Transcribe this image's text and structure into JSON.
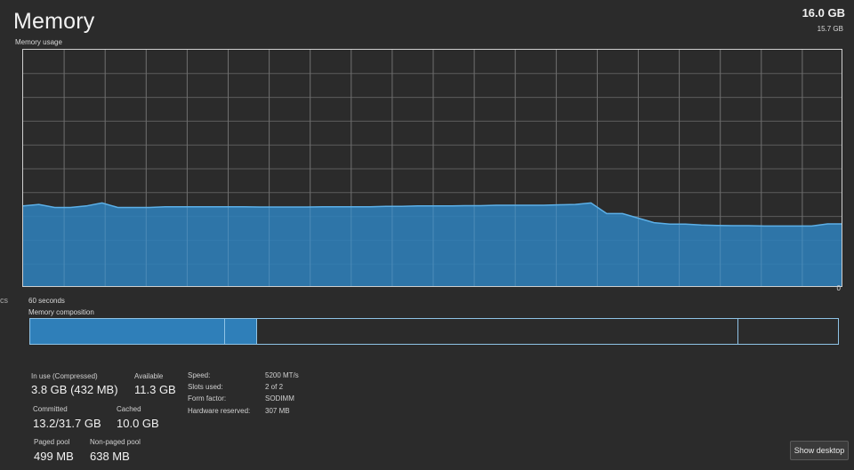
{
  "header": {
    "title": "Memory",
    "total": "16.0 GB"
  },
  "usage_graph": {
    "label": "Memory usage",
    "max": "15.7 GB",
    "time_span": "60 seconds",
    "zero": "0",
    "left_mark": "cs",
    "fill_color": "#2f7fb9",
    "line_color": "#5cb0e8"
  },
  "chart_data": {
    "type": "area",
    "x_span_seconds": 60,
    "ylim": [
      0,
      15.7
    ],
    "grid": true,
    "series": [
      {
        "values": [
          5.4,
          5.5,
          5.3,
          5.3,
          5.4,
          5.6,
          5.3,
          5.3,
          5.3,
          5.35,
          5.35,
          5.35,
          5.35,
          5.35,
          5.35,
          5.33,
          5.33,
          5.33,
          5.33,
          5.35,
          5.35,
          5.35,
          5.35,
          5.38,
          5.38,
          5.4,
          5.4,
          5.4,
          5.42,
          5.42,
          5.45,
          5.45,
          5.45,
          5.45,
          5.48,
          5.5,
          5.6,
          4.9,
          4.9,
          4.6,
          4.3,
          4.2,
          4.2,
          4.15,
          4.12,
          4.1,
          4.1,
          4.08,
          4.08,
          4.08,
          4.08,
          4.22,
          4.22
        ]
      }
    ]
  },
  "composition": {
    "label": "Memory composition",
    "segments": [
      {
        "name": "in-use",
        "fraction": 0.24,
        "color": "#2f7fb9"
      },
      {
        "name": "modified",
        "fraction": 0.04,
        "color": "#2f7fb9"
      },
      {
        "name": "standby",
        "fraction": 0.595,
        "color": "#2b2b2b"
      },
      {
        "name": "free",
        "fraction": 0.125,
        "color": "#2b2b2b"
      }
    ]
  },
  "stats": {
    "in_use_label": "In use (Compressed)",
    "in_use_value": "3.8 GB (432 MB)",
    "available_label": "Available",
    "available_value": "11.3 GB",
    "committed_label": "Committed",
    "committed_value": "13.2/31.7 GB",
    "cached_label": "Cached",
    "cached_value": "10.0 GB",
    "paged_label": "Paged pool",
    "paged_value": "499 MB",
    "nonpaged_label": "Non-paged pool",
    "nonpaged_value": "638 MB"
  },
  "specs": {
    "speed_label": "Speed:",
    "speed_value": "5200 MT/s",
    "slots_label": "Slots used:",
    "slots_value": "2 of 2",
    "form_label": "Form factor:",
    "form_value": "SODIMM",
    "hw_label": "Hardware reserved:",
    "hw_value": "307 MB"
  },
  "footer": {
    "show_desktop": "Show desktop"
  }
}
